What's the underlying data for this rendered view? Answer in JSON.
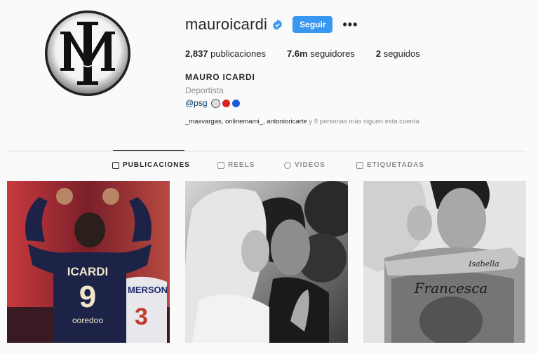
{
  "profile": {
    "username": "mauroicardi",
    "follow_label": "Seguir",
    "more_label": "•••",
    "full_name": "MAURO ICARDI",
    "category": "Deportista",
    "bio_link": "@psg",
    "followed_by": {
      "names": "_maxvargas, onlinemami_, antonioricarte",
      "suffix": "y 9 personas más siguen esta cuenta"
    }
  },
  "stats": {
    "posts_count": "2,837",
    "posts_label": "publicaciones",
    "followers_count": "7.6m",
    "followers_label": "seguidores",
    "following_count": "2",
    "following_label": "seguidos"
  },
  "tabs": [
    {
      "label": "PUBLICACIONES",
      "icon": "grid-icon",
      "active": true
    },
    {
      "label": "REELS",
      "icon": "reels-icon",
      "active": false
    },
    {
      "label": "VIDEOS",
      "icon": "video-icon",
      "active": false
    },
    {
      "label": "ETIQUETADAS",
      "icon": "tag-icon",
      "active": false
    }
  ],
  "posts": [
    {
      "jersey_name": "ICARDI",
      "jersey_number": "9",
      "sponsor": "ooredoo",
      "other_name": "MERSON",
      "other_number": "3"
    },
    {
      "description_icon": "photo-couple"
    },
    {
      "tattoo_text": "Francesca",
      "tattoo_arm": "Isabella"
    }
  ],
  "colors": {
    "accent": "#3897f0",
    "verified": "#3897f0",
    "link": "#00376b",
    "muted": "#8e8e8e"
  }
}
